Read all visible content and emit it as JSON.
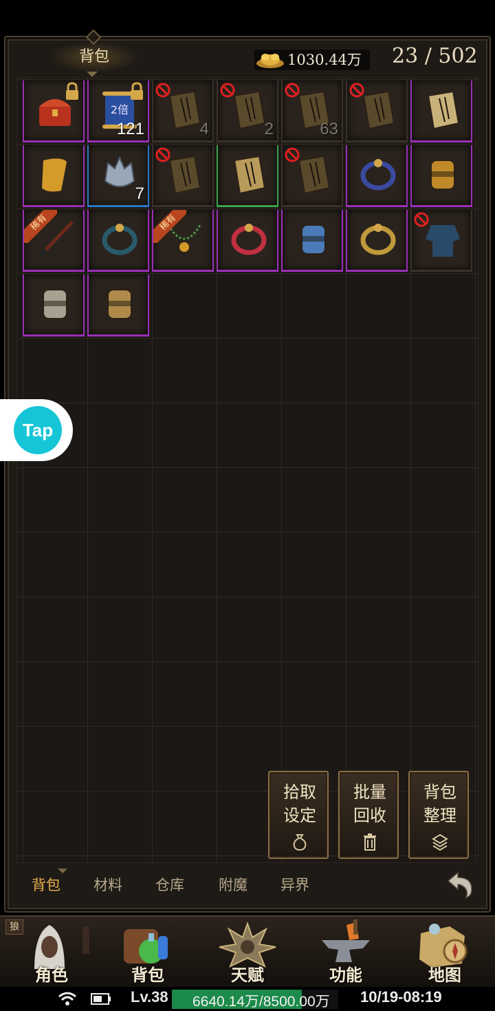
{
  "header": {
    "title": "背包",
    "gold": "1030.44万",
    "capacity": "23 / 502"
  },
  "items": [
    {
      "name": "treasure-chest",
      "quality": "purple",
      "locked": true,
      "banned": false,
      "count": "",
      "color": "#b8321e"
    },
    {
      "name": "double-exp-scroll",
      "quality": "purple",
      "locked": true,
      "banned": false,
      "count": "121",
      "color": "#2b4fa0",
      "label": "2倍"
    },
    {
      "name": "skill-book",
      "quality": "none",
      "locked": false,
      "banned": true,
      "count": "4",
      "color": "#5a4a2c"
    },
    {
      "name": "skill-book",
      "quality": "none",
      "locked": false,
      "banned": true,
      "count": "2",
      "color": "#5a4a2c"
    },
    {
      "name": "skill-book",
      "quality": "none",
      "locked": false,
      "banned": true,
      "count": "63",
      "color": "#5a4a2c"
    },
    {
      "name": "skill-book",
      "quality": "none",
      "locked": false,
      "banned": true,
      "count": "",
      "color": "#5a4a2c"
    },
    {
      "name": "skill-book",
      "quality": "purple",
      "locked": false,
      "banned": false,
      "count": "",
      "color": "#c9b27a"
    },
    {
      "name": "scroll",
      "quality": "purple",
      "locked": false,
      "banned": false,
      "count": "",
      "color": "#d49a2a"
    },
    {
      "name": "helmet",
      "quality": "blue",
      "locked": false,
      "banned": false,
      "count": "7",
      "color": "#9aa7b8"
    },
    {
      "name": "skill-book",
      "quality": "none",
      "locked": false,
      "banned": true,
      "count": "",
      "color": "#5a4a2c"
    },
    {
      "name": "skill-book",
      "quality": "green",
      "locked": false,
      "banned": false,
      "count": "",
      "color": "#b89a5a"
    },
    {
      "name": "skill-book",
      "quality": "none",
      "locked": false,
      "banned": true,
      "count": "",
      "color": "#5a4a2c"
    },
    {
      "name": "ring-blue-gold",
      "quality": "purple",
      "locked": false,
      "banned": false,
      "count": "",
      "color": "#3a4aa0"
    },
    {
      "name": "bracelet",
      "quality": "purple",
      "locked": false,
      "banned": false,
      "count": "",
      "color": "#c08a2a"
    },
    {
      "name": "blade",
      "quality": "purple",
      "locked": false,
      "banned": false,
      "count": "",
      "color": "#6a2a1a",
      "ribbon": "稀有"
    },
    {
      "name": "coil-bracelet",
      "quality": "purple",
      "locked": false,
      "banned": false,
      "count": "",
      "color": "#2a5a6a"
    },
    {
      "name": "necklace",
      "quality": "purple",
      "locked": false,
      "banned": false,
      "count": "",
      "color": "#4aa04a",
      "ribbon": "稀有"
    },
    {
      "name": "ruby-ring",
      "quality": "purple",
      "locked": false,
      "banned": false,
      "count": "",
      "color": "#c03040"
    },
    {
      "name": "arm-guard",
      "quality": "purple",
      "locked": false,
      "banned": false,
      "count": "",
      "color": "#4a7ab8"
    },
    {
      "name": "dragon-ring",
      "quality": "purple",
      "locked": false,
      "banned": false,
      "count": "",
      "color": "#c09a3a"
    },
    {
      "name": "armor",
      "quality": "none",
      "locked": false,
      "banned": true,
      "count": "",
      "color": "#2a4a6a"
    },
    {
      "name": "silver-ring",
      "quality": "purple",
      "locked": false,
      "banned": false,
      "count": "",
      "color": "#a8a090"
    },
    {
      "name": "gauntlet",
      "quality": "purple",
      "locked": false,
      "banned": false,
      "count": "",
      "color": "#b08a4a"
    }
  ],
  "actions": [
    {
      "label": "拾取设定",
      "icon": "bag-icon"
    },
    {
      "label": "批量回收",
      "icon": "trash-icon"
    },
    {
      "label": "背包整理",
      "icon": "layers-icon"
    }
  ],
  "tabs": [
    "背包",
    "材料",
    "仓库",
    "附魔",
    "异界"
  ],
  "tap_badge": "Tap",
  "bottom_nav": [
    {
      "label": "角色",
      "icon": "character-icon"
    },
    {
      "label": "背包",
      "icon": "backpack-icon"
    },
    {
      "label": "天赋",
      "icon": "talent-icon"
    },
    {
      "label": "功能",
      "icon": "anvil-icon"
    },
    {
      "label": "地图",
      "icon": "map-icon"
    }
  ],
  "nav_tag": "狼",
  "status": {
    "level": "Lv.38",
    "exp_text": "6640.14万/8500.00万",
    "exp_fraction": 0.781,
    "clock": "10/19-08:19"
  },
  "colors": {
    "purple": "#9b2fb8",
    "blue": "#2a78c4",
    "green": "#3ca34a",
    "accent_tab": "#e8b04a",
    "exp": "#1b8a4a"
  }
}
